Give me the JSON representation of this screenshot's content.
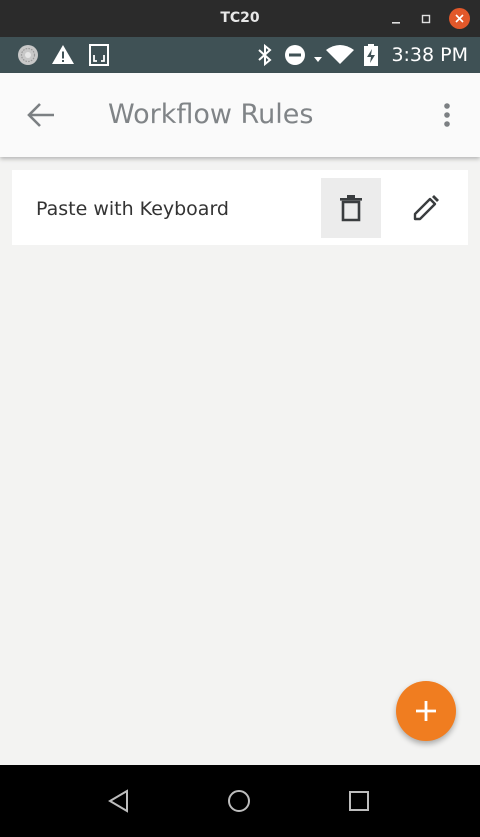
{
  "window": {
    "title": "TC20"
  },
  "statusbar": {
    "time": "3:38 PM",
    "icons": [
      "zebra-logo-icon",
      "warning-icon",
      "sim-card-icon",
      "bluetooth-icon",
      "do-not-disturb-icon",
      "wifi-icon",
      "battery-charging-icon"
    ]
  },
  "appbar": {
    "title": "Workflow Rules"
  },
  "rules": [
    {
      "label": "Paste with Keyboard"
    }
  ],
  "colors": {
    "accent": "#f07d20",
    "statusbar": "#3f5155",
    "background": "#f3f3f2"
  }
}
